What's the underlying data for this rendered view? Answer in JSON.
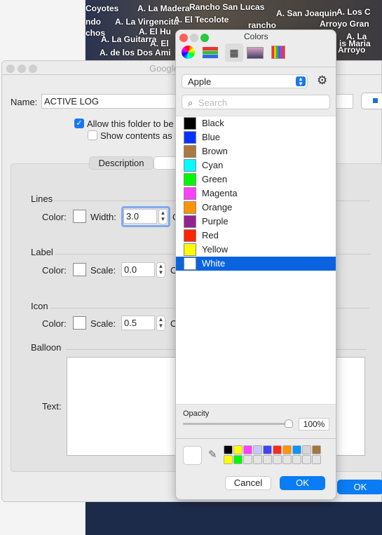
{
  "map": {
    "labels": [
      "Coyotes",
      "A. La Madera",
      "Rancho San Lucas",
      "A. San Joaquin",
      "A. Los C",
      "ndo",
      "A. La Virgencita",
      "A. El Tecolote",
      "rancho",
      "Arroyo Gran",
      "chos",
      "A. El Hu",
      "A. La Guitarra",
      "A. El",
      "A. La",
      "is Maria",
      "A. de los Dos Ami",
      "Arroyo"
    ]
  },
  "dialog": {
    "title": "Google",
    "name_label": "Name:",
    "name_value": "ACTIVE LOG",
    "allow_label": "Allow this folder to be",
    "allow_checked": true,
    "show_label": "Show contents as",
    "show_checked": false,
    "tab_description": "Description",
    "lines": {
      "heading": "Lines",
      "color_label": "Color:",
      "width_label": "Width:",
      "width_value": "3.0",
      "trailing": "O"
    },
    "label": {
      "heading": "Label",
      "color_label": "Color:",
      "scale_label": "Scale:",
      "scale_value": "0.0",
      "trailing": "O"
    },
    "icon": {
      "heading": "Icon",
      "color_label": "Color:",
      "scale_label": "Scale:",
      "scale_value": "0.5",
      "trailing": "O"
    },
    "balloon": {
      "heading": "Balloon",
      "text_label": "Text:"
    },
    "ok_label": "OK"
  },
  "colors": {
    "title": "Colors",
    "palette_select": "Apple",
    "search_placeholder": "Search",
    "items": [
      {
        "name": "Black",
        "hex": "#000000"
      },
      {
        "name": "Blue",
        "hex": "#0433ff"
      },
      {
        "name": "Brown",
        "hex": "#aa7942"
      },
      {
        "name": "Cyan",
        "hex": "#00fdff"
      },
      {
        "name": "Green",
        "hex": "#00f900"
      },
      {
        "name": "Magenta",
        "hex": "#ff40ff"
      },
      {
        "name": "Orange",
        "hex": "#ff9300"
      },
      {
        "name": "Purple",
        "hex": "#942192"
      },
      {
        "name": "Red",
        "hex": "#ff2600"
      },
      {
        "name": "Yellow",
        "hex": "#fffb00"
      },
      {
        "name": "White",
        "hex": "#ffffff"
      }
    ],
    "selected": "White",
    "opacity_label": "Opacity",
    "opacity_value": "100%",
    "opacity": 1.0,
    "swatches": [
      "#000000",
      "#fffb00",
      "#ff40ff",
      "#c5c8ff",
      "#3b46ff",
      "#ff2a17",
      "#ff9300",
      "#0a96ff",
      "#d6d6d6",
      "#a57640",
      "#fffb00",
      "#00f900"
    ],
    "cancel_label": "Cancel",
    "ok_label": "OK",
    "accent": "#0a64e0"
  }
}
